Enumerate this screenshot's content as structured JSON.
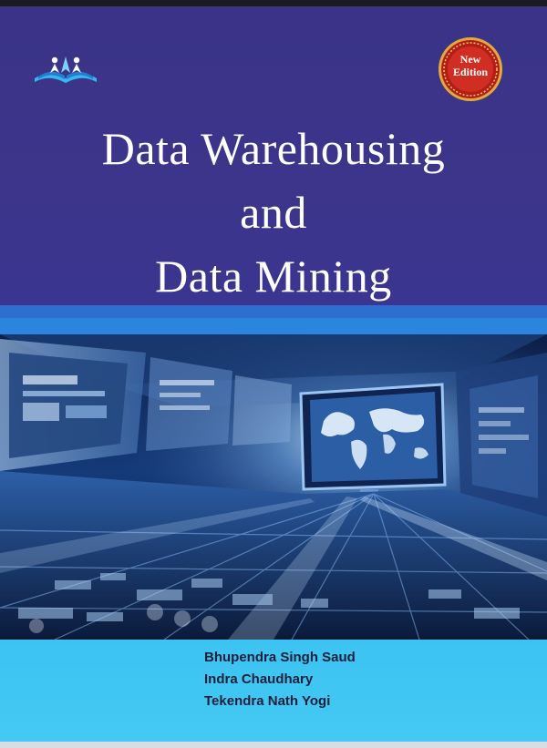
{
  "cover": {
    "title_lines": [
      "Data Warehousing",
      "and",
      "Data Mining"
    ],
    "badge": {
      "line1": "New",
      "line2": "Edition"
    },
    "authors": [
      "Bhupendra Singh Saud",
      "Indra Chaudhary",
      "Tekendra Nath Yogi"
    ],
    "publisher_logo": "open-book-with-figures-logo",
    "cover_image": "digital-data-tunnel-with-monitors-and-world-map",
    "colors": {
      "title_band": "#3c358b",
      "accent_stripe": "#2a86dd",
      "footer_band": "#45c9f4",
      "badge_red": "#c8281e",
      "badge_gold": "#e3a93a",
      "author_text": "#1a1f3a"
    }
  }
}
